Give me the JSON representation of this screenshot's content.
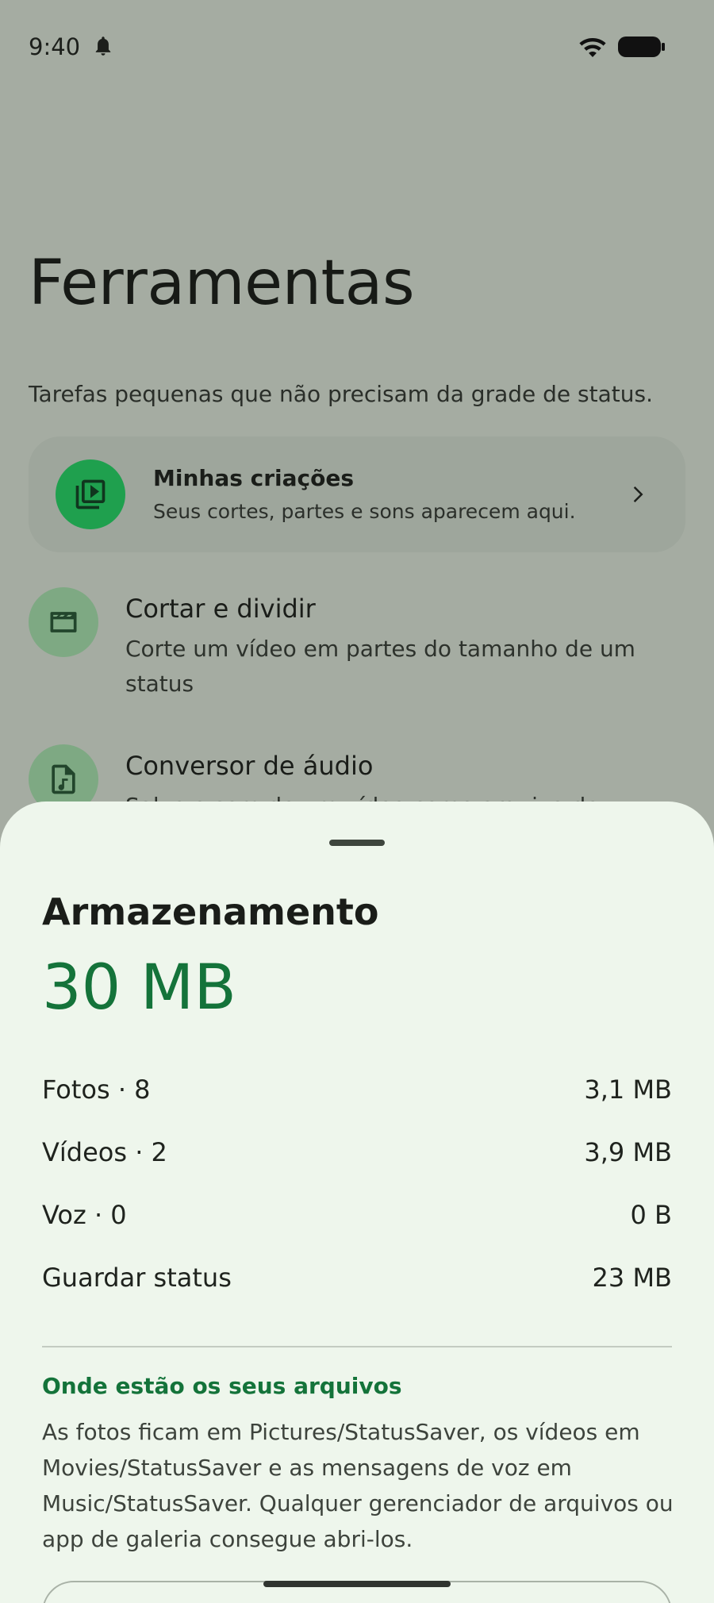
{
  "status_bar": {
    "time": "9:40"
  },
  "page": {
    "title": "Ferramentas",
    "subtitle": "Tarefas pequenas que não precisam da grade de status."
  },
  "creations": {
    "title": "Minhas criações",
    "description": "Seus cortes, partes e sons aparecem aqui."
  },
  "tools": [
    {
      "title": "Cortar e dividir",
      "description": "Corte um vídeo em partes do tamanho de um status"
    },
    {
      "title": "Conversor de áudio",
      "description": "Salve o som de um vídeo como arquivo de áudio"
    }
  ],
  "storage": {
    "title": "Armazenamento",
    "total": "30 MB",
    "rows": [
      {
        "label": "Fotos · 8",
        "size": "3,1 MB"
      },
      {
        "label": "Vídeos · 2",
        "size": "3,9 MB"
      },
      {
        "label": "Voz · 0",
        "size": "0 B"
      },
      {
        "label": "Guardar status",
        "size": "23 MB"
      }
    ],
    "files_heading": "Onde estão os seus arquivos",
    "files_description": "As fotos ficam em Pictures/StatusSaver, os vídeos em Movies/StatusSaver e as mensagens de voz em Music/StatusSaver. Qualquer gerenciador de arquivos ou app de galeria consegue abri-los."
  },
  "colors": {
    "accent": "#14733a",
    "scrim_background": "#a5aca2",
    "sheet_background": "#eef6ec",
    "icon_green": "#1fa04e"
  },
  "icons": {
    "notification": "bell-icon",
    "wifi": "wifi-icon",
    "battery": "battery-icon",
    "creations": "video-library-icon",
    "trim": "clapperboard-icon",
    "audio": "audio-file-icon",
    "chevron": "chevron-right-icon"
  }
}
